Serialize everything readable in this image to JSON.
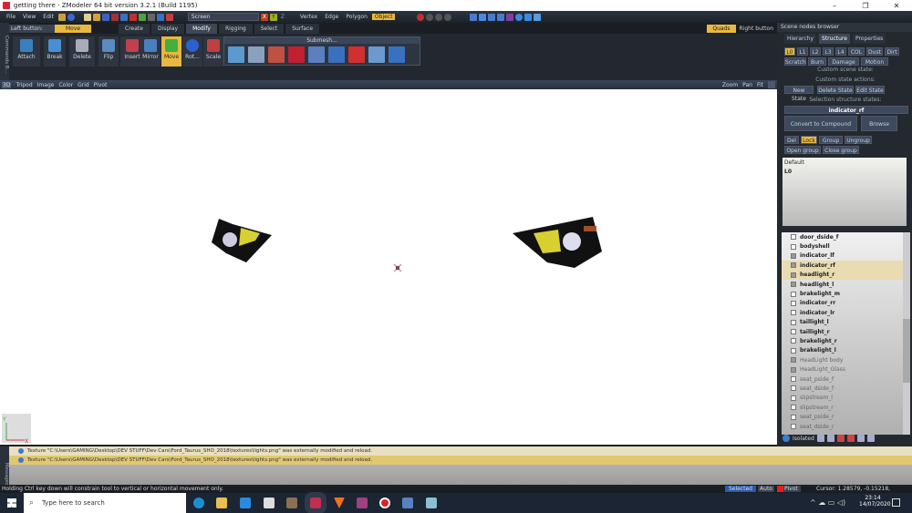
{
  "window": {
    "title": "getting there - ZModeler 64 bit version 3.2.1 (Build 1195)",
    "minimize": "–",
    "restore": "❐",
    "close": "✕"
  },
  "menu": [
    "File",
    "View",
    "Edit"
  ],
  "toolbar": {
    "coord_combo": "Screen",
    "axes": [
      "X",
      "Y",
      "Z"
    ],
    "modes": [
      "Vertex",
      "Edge",
      "Polygon",
      "Object"
    ],
    "active_mode": "Object"
  },
  "row2": {
    "left_button": "Left button:",
    "left_action": "Move",
    "tabs": [
      "Create",
      "Display",
      "Modify",
      "Rigging",
      "Select",
      "Surface"
    ],
    "active_tab": "Modify",
    "right_action": "Quads",
    "right_button": "Right button"
  },
  "ribbon": {
    "tools": [
      "Attach",
      "Break",
      "Delete",
      "Flip",
      "Insert",
      "Mirror",
      "Move",
      "Rot...",
      "Scale"
    ],
    "active_tool": "Move",
    "submesh_label": "Submesh..."
  },
  "side_tab": "Commands B...",
  "viewport_header": {
    "items": [
      "3D",
      "Tripod",
      "Image",
      "Color",
      "Grid",
      "Pivot"
    ],
    "right": [
      "Zoom",
      "Pan",
      "Fit"
    ]
  },
  "panel": {
    "title": "Scene nodes browser",
    "tabs": [
      "Hierarchy",
      "Structure",
      "Properties"
    ],
    "active_tab": "Structure",
    "levels": [
      "L0",
      "L1",
      "L2",
      "L3",
      "L4",
      "COL",
      "Dust",
      "Dirt"
    ],
    "levels2": [
      "Scratch",
      "Burn",
      "Damage",
      "Motion"
    ],
    "custom_scene_state": "Custom scene state:",
    "custom_state_actions": "Custom state actions:",
    "state_buttons": [
      "New State",
      "Delete State",
      "Edit State"
    ],
    "selection_states": "Selection structure states:",
    "selected_node": "indicator_rf",
    "convert_button": "Convert to Compound",
    "browse_button": "Browse",
    "group_buttons": [
      "Del",
      "Lock",
      "Group",
      "Ungroup"
    ],
    "group_buttons2": [
      "Open group",
      "Close group"
    ],
    "state_list_header": "Default",
    "state_list_item": "L0",
    "footer_label": "Isolated"
  },
  "tree": [
    {
      "name": "door_dside_f",
      "check": false,
      "style": "normal"
    },
    {
      "name": "bodyshell",
      "check": false,
      "style": "normal"
    },
    {
      "name": "indicator_lf",
      "check": true,
      "style": "normal"
    },
    {
      "name": "indicator_rf",
      "check": true,
      "style": "selected"
    },
    {
      "name": "headlight_r",
      "check": true,
      "style": "selected"
    },
    {
      "name": "headlight_l",
      "check": true,
      "style": "normal"
    },
    {
      "name": "brakelight_m",
      "check": false,
      "style": "normal"
    },
    {
      "name": "indicator_rr",
      "check": false,
      "style": "normal"
    },
    {
      "name": "indicator_lr",
      "check": false,
      "style": "normal"
    },
    {
      "name": "taillight_l",
      "check": false,
      "style": "normal"
    },
    {
      "name": "taillight_r",
      "check": false,
      "style": "normal"
    },
    {
      "name": "brakelight_r",
      "check": false,
      "style": "normal"
    },
    {
      "name": "brakelight_l",
      "check": false,
      "style": "normal"
    },
    {
      "name": "HeadLight body",
      "check": true,
      "style": "dim"
    },
    {
      "name": "HeadLight_Glass",
      "check": true,
      "style": "dim"
    },
    {
      "name": "seat_pside_f",
      "check": false,
      "style": "dim"
    },
    {
      "name": "seat_dside_f",
      "check": false,
      "style": "dim"
    },
    {
      "name": "slipstream_l",
      "check": false,
      "style": "dim"
    },
    {
      "name": "slipstream_r",
      "check": false,
      "style": "dim"
    },
    {
      "name": "seat_pside_r",
      "check": false,
      "style": "dim"
    },
    {
      "name": "seat_dside_r",
      "check": false,
      "style": "dim"
    }
  ],
  "log": [
    "Texture \"C:\\Users\\GAMING\\Desktop\\DEV STUFF\\Dev Cars\\Ford_Taurus_SHO_2018\\textures\\lights.png\" was externally modified and reload.",
    "Texture \"C:\\Users\\GAMING\\Desktop\\DEV STUFF\\Dev Cars\\Ford_Taurus_SHO_2018\\textures\\lights.png\" was externally modified and reload."
  ],
  "log_side_tab": "Messages",
  "status": {
    "hint": "Holding Ctrl key down will constrain tool to vertical or horizontal movement only.",
    "selected": "Selected",
    "auto": "Auto",
    "pivot": "Pivot",
    "cursor": "Cursor: 1.28579, -0.15218, -1.58326"
  },
  "taskbar": {
    "search_placeholder": "Type here to search",
    "time": "23:14",
    "date": "14/07/2020"
  },
  "colors": {
    "accent": "#e8b840",
    "panel": "#24292f",
    "selected_row": "#e8dcb0"
  }
}
